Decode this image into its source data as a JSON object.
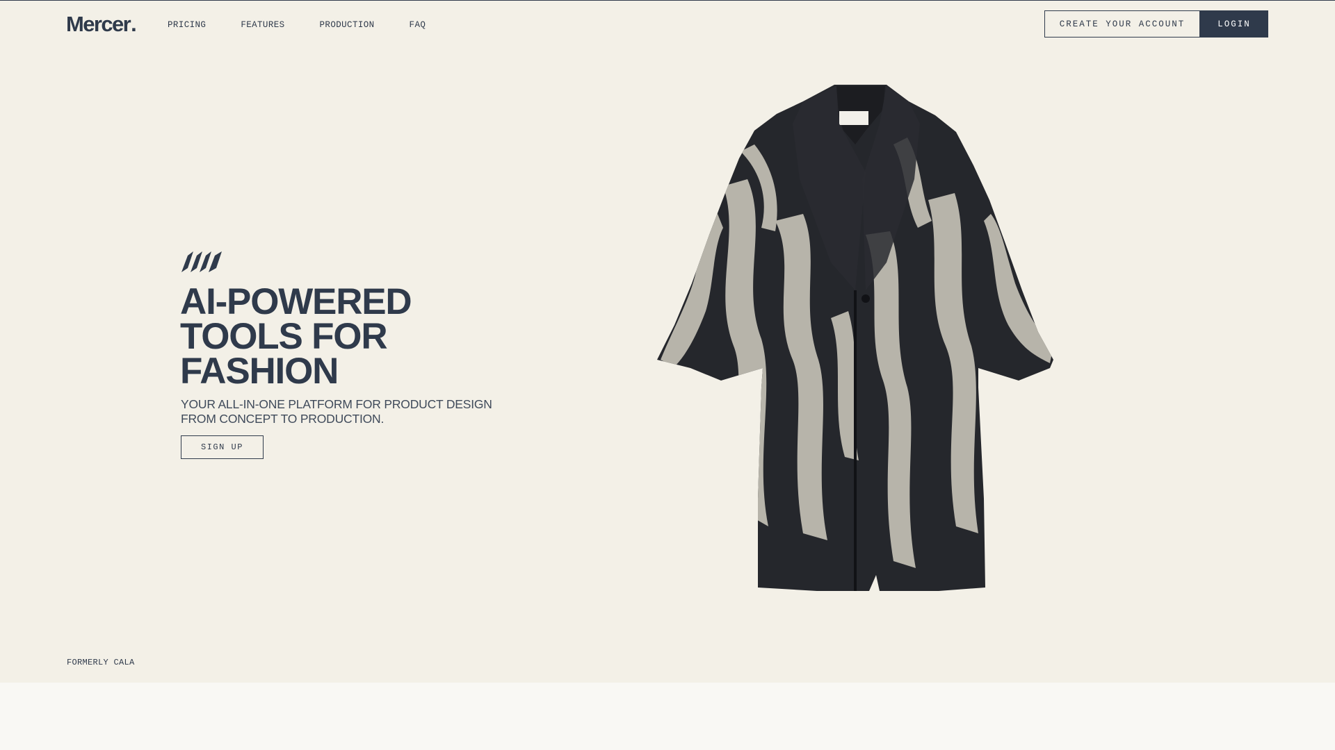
{
  "brand": {
    "name": "Mercer",
    "dot": "."
  },
  "nav": {
    "items": [
      {
        "label": "PRICING"
      },
      {
        "label": "FEATURES"
      },
      {
        "label": "PRODUCTION"
      },
      {
        "label": "FAQ"
      }
    ]
  },
  "header_actions": {
    "create_account_label": "CREATE YOUR ACCOUNT",
    "login_label": "LOGIN"
  },
  "hero": {
    "mark_icon": "stripes-logo-mark-icon",
    "title_lines": [
      "AI-POWERED",
      "TOOLS FOR",
      "FASHION"
    ],
    "subtitle_lines": [
      "YOUR ALL-IN-ONE PLATFORM FOR PRODUCT DESIGN",
      "FROM CONCEPT TO PRODUCTION."
    ],
    "signup_label": "SIGN UP"
  },
  "product_image": {
    "description_icon": "zebra-print-coat-image"
  },
  "footer_note": "FORMERLY CALA",
  "colors": {
    "background": "#f3f0e7",
    "lower_band": "#f9f8f4",
    "ink": "#2f3a4b",
    "login_bg": "#2f3a4b",
    "login_text": "#ffffff"
  }
}
